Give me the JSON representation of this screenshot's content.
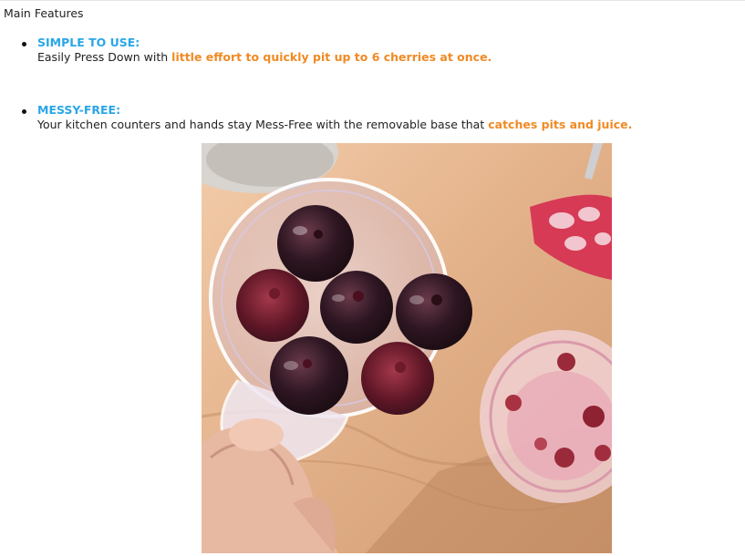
{
  "heading": "Main Features",
  "features": [
    {
      "title": "SIMPLE TO USE:",
      "text_before": "Easily Press Down with ",
      "highlight": "little effort to quickly pit up to 6 cherries at once.",
      "text_after": ""
    },
    {
      "title": "MESSY-FREE:",
      "text_before": "Your kitchen counters and hands stay Mess-Free with the removable base that ",
      "highlight": "catches pits and juice.",
      "text_after": ""
    }
  ],
  "colors": {
    "title_blue": "#2aa6e6",
    "highlight_orange": "#f08a24",
    "text": "#222222"
  },
  "image": {
    "subject": "cherry-pitter-tray-with-cherries-photo"
  }
}
